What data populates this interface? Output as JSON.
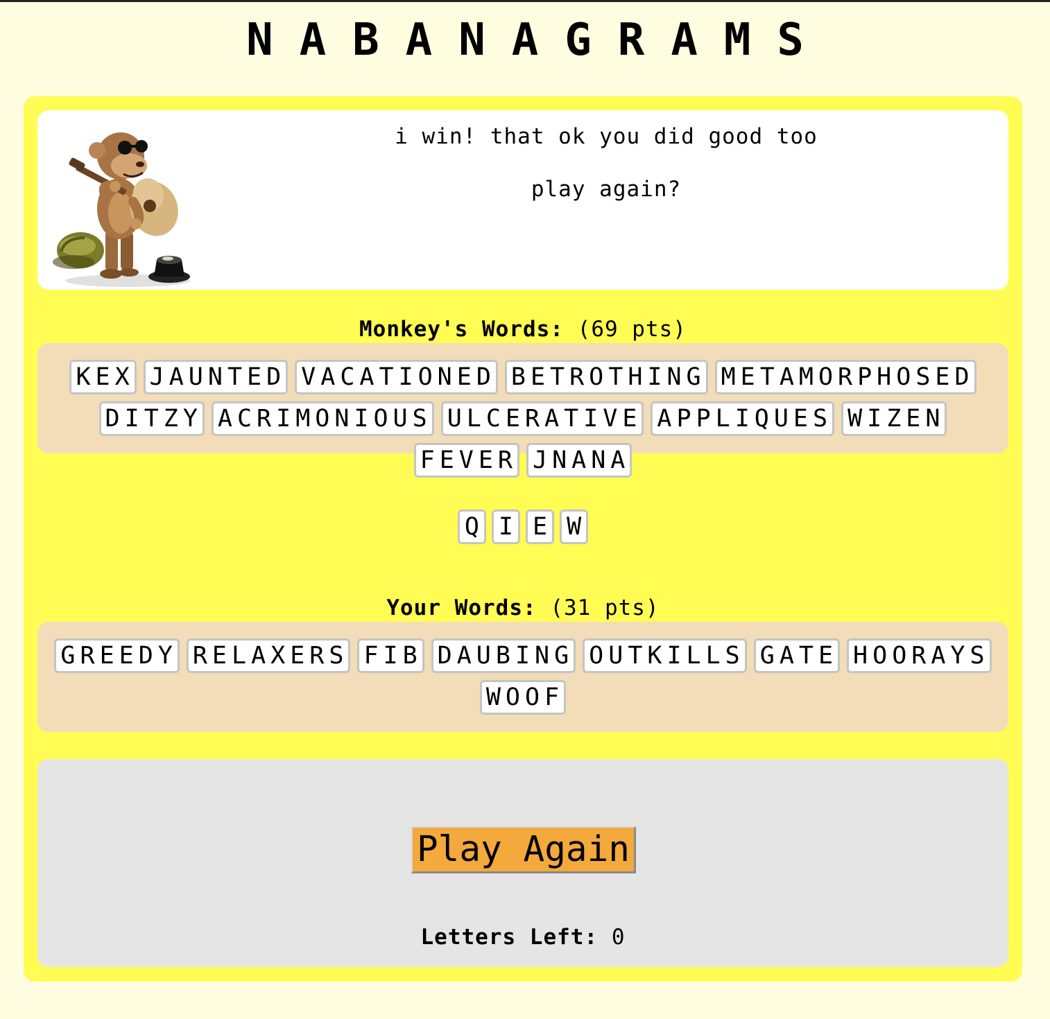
{
  "title": "NABANAGRAMS",
  "message": {
    "line1": "i win! that ok you did good too",
    "line2": "play again?"
  },
  "monkey_words": {
    "label": "Monkey's Words:",
    "points": "(69 pts)",
    "words": [
      "KEX",
      "JAUNTED",
      "VACATIONED",
      "BETROTHING",
      "METAMORPHOSED",
      "DITZY",
      "ACRIMONIOUS",
      "ULCERATIVE",
      "APPLIQUES",
      "WIZEN",
      "FEVER",
      "JNANA"
    ]
  },
  "pool": {
    "letters": [
      "Q",
      "I",
      "E",
      "W"
    ]
  },
  "your_words": {
    "label": "Your Words:",
    "points": "(31 pts)",
    "words": [
      "GREEDY",
      "RELAXERS",
      "FIB",
      "DAUBING",
      "OUTKILLS",
      "GATE",
      "HOORAYS",
      "WOOF"
    ]
  },
  "controls": {
    "play_again_label": "Play Again",
    "letters_left_label": "Letters Left:",
    "letters_left_value": "0"
  },
  "colors": {
    "page_bg": "#fffde0",
    "board_bg": "#fffc54",
    "words_bg": "#f2ddb8",
    "control_bg": "#e5e5e5",
    "button_bg": "#f3a93b"
  },
  "icons": {
    "monkey": "guitar-playing-monkey-icon"
  }
}
